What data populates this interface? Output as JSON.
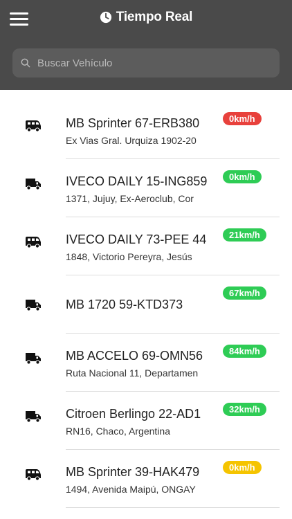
{
  "header": {
    "title": "Tiempo Real",
    "search_placeholder": "Buscar Vehículo"
  },
  "colors": {
    "header_bg": "#4a4a4a",
    "speed_red": "#e8413c",
    "speed_green": "#2ecc55",
    "speed_yellow": "#f5c400"
  },
  "vehicles": [
    {
      "name": "MB Sprinter 67-ERB380",
      "address": "Ex Vias Gral. Urquiza 1902-20",
      "speed": "0km/h",
      "status": "red",
      "icon": "van-icon"
    },
    {
      "name": "IVECO DAILY 15-ING859",
      "address": "1371, Jujuy, Ex-Aeroclub, Cor",
      "speed": "0km/h",
      "status": "green",
      "icon": "truck-icon"
    },
    {
      "name": "IVECO DAILY 73-PEE 44",
      "address": "1848, Victorio Pereyra, Jesús",
      "speed": "21km/h",
      "status": "green",
      "icon": "van-icon"
    },
    {
      "name": "MB 1720 59-KTD373",
      "address": "",
      "speed": "67km/h",
      "status": "green",
      "icon": "truck-icon"
    },
    {
      "name": "MB ACCELO 69-OMN56",
      "address": "Ruta Nacional 11, Departamen",
      "speed": "84km/h",
      "status": "green",
      "icon": "truck-icon"
    },
    {
      "name": "Citroen Berlingo 22-AD1",
      "address": "RN16, Chaco, Argentina",
      "speed": "32km/h",
      "status": "green",
      "icon": "truck-icon"
    },
    {
      "name": "MB Sprinter 39-HAK479",
      "address": "1494, Avenida Maipú, ONGAY",
      "speed": "0km/h",
      "status": "yellow",
      "icon": "van-icon"
    }
  ]
}
